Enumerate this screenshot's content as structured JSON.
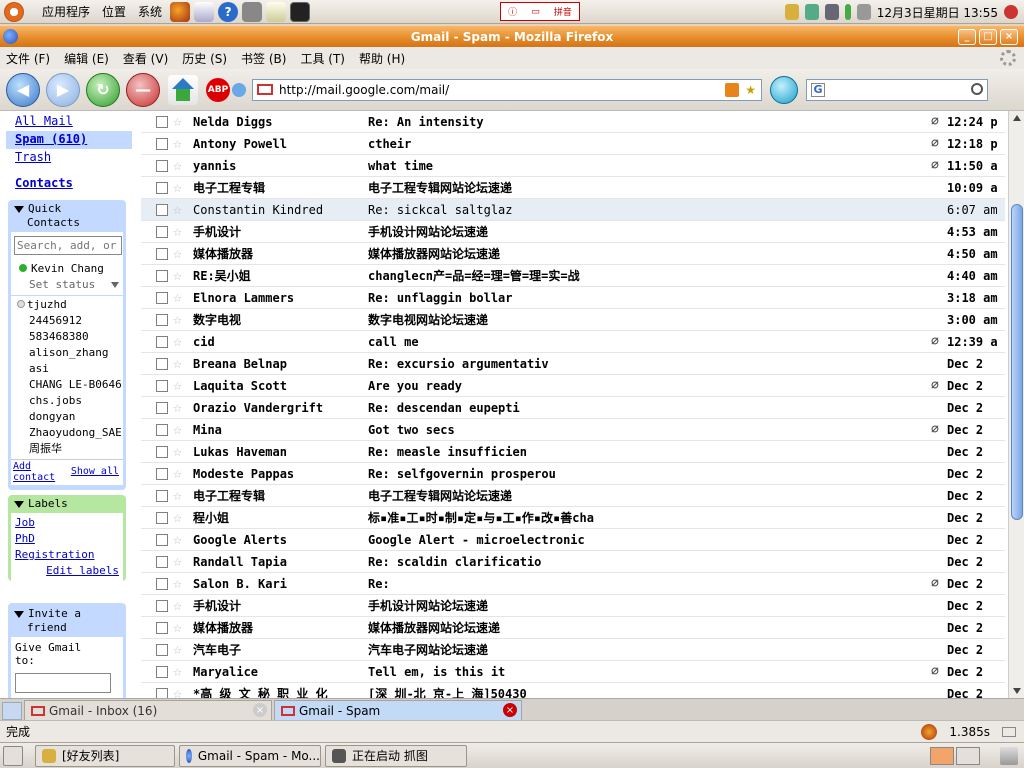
{
  "top_panel": {
    "menus": [
      "应用程序",
      "位置",
      "系统"
    ],
    "ime": [
      "ⓘ",
      "拼音"
    ],
    "clock": "12月3日星期日 13:55"
  },
  "window": {
    "title": "Gmail - Spam - Mozilla Firefox",
    "controls": [
      "_",
      "□",
      "×"
    ]
  },
  "menubar": [
    "文件 (F)",
    "编辑 (E)",
    "查看 (V)",
    "历史 (S)",
    "书签 (B)",
    "工具 (T)",
    "帮助 (H)"
  ],
  "navbar": {
    "url": "http://mail.google.com/mail/",
    "search_engine": "G",
    "abp": "ABP"
  },
  "sidebar": {
    "links": {
      "all_mail": "All Mail",
      "spam": "Spam (610)",
      "trash": "Trash",
      "contacts": "Contacts"
    },
    "quick_contacts": {
      "title_1": "Quick",
      "title_2": "Contacts",
      "search_placeholder": "Search, add, or",
      "me": "Kevin Chang",
      "status": "Set status",
      "contacts": [
        "tjuzhd",
        "24456912",
        "583468380",
        "alison_zhang",
        "asi",
        "CHANG LE-B0646",
        "chs.jobs",
        "dongyan",
        "Zhaoyudong_SAE",
        "周振华"
      ],
      "add_1": "Add",
      "add_2": "contact",
      "show_all": "Show all"
    },
    "labels": {
      "title": "Labels",
      "items": [
        "Job",
        "PhD",
        "Registration"
      ],
      "edit": "Edit labels"
    },
    "invite": {
      "title_1": "Invite a",
      "title_2": "friend",
      "give_1": "Give Gmail",
      "give_2": "to:"
    }
  },
  "emails": [
    {
      "sender": "Nelda Diggs",
      "subject": "Re: An intensity",
      "clip": "⌀",
      "time": "12:24 p"
    },
    {
      "sender": "Antony Powell",
      "subject": "ctheir",
      "clip": "⌀",
      "time": "12:18 p"
    },
    {
      "sender": "yannis",
      "subject": "what time",
      "clip": "⌀",
      "time": "11:50 a"
    },
    {
      "sender": "电子工程专辑",
      "subject": "电子工程专辑网站论坛速递",
      "clip": "",
      "time": "10:09 a"
    },
    {
      "sender": "Constantin Kindred",
      "subject": "Re: sickcal saltglaz",
      "clip": "",
      "time": "6:07 am"
    },
    {
      "sender": "手机设计",
      "subject": "手机设计网站论坛速递",
      "clip": "",
      "time": "4:53 am"
    },
    {
      "sender": "媒体播放器",
      "subject": "媒体播放器网站论坛速递",
      "clip": "",
      "time": "4:50 am"
    },
    {
      "sender": "RE:吴小姐",
      "subject": "changlecn产=品=经=理=管=理=实=战",
      "clip": "",
      "time": "4:40 am"
    },
    {
      "sender": "Elnora Lammers",
      "subject": "Re: unflaggin bollar",
      "clip": "",
      "time": "3:18 am"
    },
    {
      "sender": "数字电视",
      "subject": "数字电视网站论坛速递",
      "clip": "",
      "time": "3:00 am"
    },
    {
      "sender": "cid",
      "subject": "call me",
      "clip": "⌀",
      "time": "12:39 a"
    },
    {
      "sender": "Breana Belnap",
      "subject": "Re: excursio argumentativ",
      "clip": "",
      "time": "Dec 2"
    },
    {
      "sender": "Laquita Scott",
      "subject": "Are you ready",
      "clip": "⌀",
      "time": "Dec 2"
    },
    {
      "sender": "Orazio Vandergrift",
      "subject": "Re: descendan eupepti",
      "clip": "",
      "time": "Dec 2"
    },
    {
      "sender": "Mina",
      "subject": "Got two secs",
      "clip": "⌀",
      "time": "Dec 2"
    },
    {
      "sender": "Lukas Haveman",
      "subject": "Re: measle insufficien",
      "clip": "",
      "time": "Dec 2"
    },
    {
      "sender": "Modeste Pappas",
      "subject": "Re: selfgovernin prosperou",
      "clip": "",
      "time": "Dec 2"
    },
    {
      "sender": "电子工程专辑",
      "subject": "电子工程专辑网站论坛速递",
      "clip": "",
      "time": "Dec 2"
    },
    {
      "sender": "程小姐",
      "subject": "标▪准▪工▪时▪制▪定▪与▪工▪作▪改▪善cha",
      "clip": "",
      "time": "Dec 2"
    },
    {
      "sender": "Google Alerts",
      "subject": "Google Alert - microelectronic",
      "clip": "",
      "time": "Dec 2"
    },
    {
      "sender": "Randall Tapia",
      "subject": "Re: scaldin clarificatio",
      "clip": "",
      "time": "Dec 2"
    },
    {
      "sender": "Salon B. Kari",
      "subject": "Re:",
      "clip": "⌀",
      "time": "Dec 2"
    },
    {
      "sender": "手机设计",
      "subject": "手机设计网站论坛速递",
      "clip": "",
      "time": "Dec 2"
    },
    {
      "sender": "媒体播放器",
      "subject": "媒体播放器网站论坛速递",
      "clip": "",
      "time": "Dec 2"
    },
    {
      "sender": "汽车电子",
      "subject": "汽车电子网站论坛速递",
      "clip": "",
      "time": "Dec 2"
    },
    {
      "sender": "Maryalice",
      "subject": "Tell em, is this it",
      "clip": "⌀",
      "time": "Dec 2"
    },
    {
      "sender": "*高 级 文 秘 职 业 化",
      "subject": "[深 圳-北 京-上 海]50430",
      "clip": "",
      "time": "Dec 2"
    }
  ],
  "tabs": [
    {
      "label": "Gmail - Inbox (16)",
      "active": false
    },
    {
      "label": "Gmail - Spam",
      "active": true
    }
  ],
  "statusbar": {
    "left": "完成",
    "timer": "1.385s"
  },
  "taskbar": [
    {
      "label": "[好友列表]"
    },
    {
      "label": "Gmail - Spam - Mo..."
    },
    {
      "label": "正在启动 抓图"
    }
  ],
  "colors": {
    "titlebar": "#e48a28",
    "link": "#0000cc",
    "selected_nav": "#c3d9ff",
    "labels_box": "#b6e7a1"
  }
}
